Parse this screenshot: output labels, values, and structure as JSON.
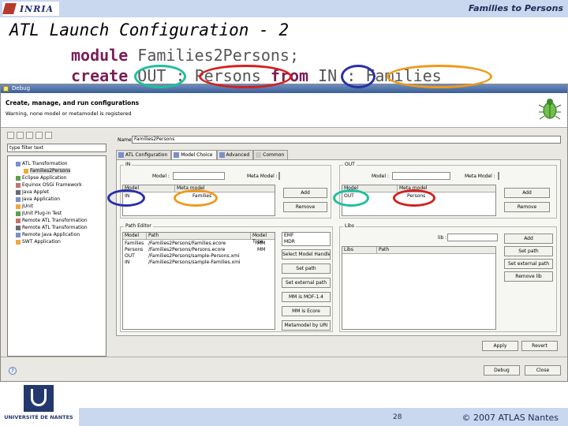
{
  "header": {
    "brand": "INRIA",
    "topic": "Families to Persons"
  },
  "slide": {
    "title": "ATL Launch Configuration - 2",
    "code": {
      "kw_module": "module",
      "module_name": "Families2Persons;",
      "kw_create": "create",
      "out_name": "OUT",
      "colon1": ":",
      "out_metamodel": "Persons",
      "kw_from": "from",
      "in_name": "IN",
      "colon2": ":",
      "in_metamodel": "Families"
    }
  },
  "dialog": {
    "window_title": "Debug",
    "header_title": "Create, manage, and run configurations",
    "header_message": "Warning, none model or metamodel is registered",
    "filter_placeholder": "type filter text",
    "name_label": "Name:",
    "name_value": "Families2Persons",
    "tree": [
      {
        "label": "ATL Transformation",
        "indent": 1
      },
      {
        "label": "Families2Persons",
        "indent": 2,
        "selected": true
      },
      {
        "label": "Eclipse Application",
        "indent": 1
      },
      {
        "label": "Equinox OSGi Framework",
        "indent": 1
      },
      {
        "label": "Java Applet",
        "indent": 1
      },
      {
        "label": "Java Application",
        "indent": 1
      },
      {
        "label": "JUnit",
        "indent": 1
      },
      {
        "label": "JUnit Plug-in Test",
        "indent": 1
      },
      {
        "label": "Remote ATL Transformation",
        "indent": 1
      },
      {
        "label": "Remote ATL Transformation",
        "indent": 1
      },
      {
        "label": "Remote Java Application",
        "indent": 1
      },
      {
        "label": "SWT Application",
        "indent": 1
      }
    ],
    "tabs": [
      {
        "label": "ATL Configuration"
      },
      {
        "label": "Model Choice"
      },
      {
        "label": "Advanced"
      },
      {
        "label": "Common"
      }
    ],
    "in_group": {
      "title": "IN",
      "model_label": "Model :",
      "metamodel_label": "Meta Model :",
      "add": "Add",
      "remove": "Remove",
      "col_model": "Model",
      "col_metamodel": "Meta model",
      "row_model": "IN",
      "row_metamodel": "Families"
    },
    "out_group": {
      "title": "OUT",
      "model_label": "Model :",
      "metamodel_label": "Meta Model :",
      "add": "Add",
      "remove": "Remove",
      "col_model": "Model",
      "col_metamodel": "Meta model",
      "row_model": "OUT",
      "row_metamodel": "Persons"
    },
    "path_group": {
      "title": "Path Editor",
      "cols": [
        "Model",
        "Path",
        "Model Type"
      ],
      "rows": [
        {
          "model": "Families",
          "path": "/Families2Persons/Families.ecore",
          "type": "MM"
        },
        {
          "model": "Persons",
          "path": "/Families2Persons/Persons.ecore",
          "type": "MM"
        },
        {
          "model": "OUT",
          "path": "/Families2Persons/sample-Persons.xmi",
          "type": ""
        },
        {
          "model": "IN",
          "path": "/Families2Persons/sample-Families.xmi",
          "type": ""
        }
      ],
      "mm_types": [
        "EMF",
        "MDR"
      ],
      "buttons": [
        "Select Model Handler",
        "Set path",
        "Set external path",
        "MM is MOF-1.4",
        "MM is Ecore",
        "Metamodel by URI"
      ]
    },
    "libs_group": {
      "title": "Libs",
      "lib_label": "lib :",
      "col_libs": "Libs",
      "col_path": "Path",
      "buttons": [
        "Add",
        "Set path",
        "Set external path",
        "Remove lib"
      ]
    },
    "apply": "Apply",
    "revert": "Revert",
    "debug": "Debug",
    "close": "Close"
  },
  "footer": {
    "university": "UNIVERSITÉ DE NANTES",
    "page": "28",
    "copyright": "© 2007 ATLAS Nantes"
  },
  "colors": {
    "out_ring": "#1fbf9c",
    "persons_ring": "#d32020",
    "in_ring": "#2a2fa8",
    "families_ring": "#ef9a1a",
    "band": "#c9d7ef"
  }
}
